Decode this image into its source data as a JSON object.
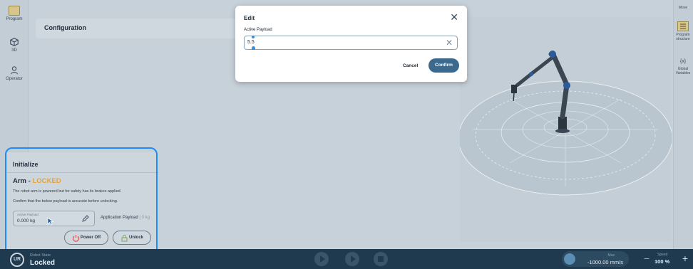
{
  "left_rail": {
    "items": [
      {
        "label": "Program",
        "icon": "program-icon"
      },
      {
        "label": "3D",
        "icon": "cube-icon"
      },
      {
        "label": "Operator",
        "icon": "person-icon"
      }
    ]
  },
  "right_rail": {
    "items": [
      {
        "label": "Move"
      },
      {
        "label": "Program structure"
      },
      {
        "icon_text": "{x}",
        "label": "Global Variables"
      }
    ]
  },
  "config": {
    "title": "Configuration"
  },
  "modal": {
    "title": "Edit",
    "close": "✕",
    "field_label": "Active Payload",
    "field_value": "5.5",
    "clear": "✕",
    "cancel": "Cancel",
    "confirm": "Confirm"
  },
  "initialize": {
    "title": "Initialize",
    "arm_prefix": "Arm -",
    "arm_state": "LOCKED",
    "text1": "The robot arm is powered but for safety has its brakes applied.",
    "text2": "Confirm that the below payload is accurate before unlocking.",
    "payload_label": "Active Payload",
    "payload_value": "0.000 kg",
    "app_payload_label": "Application Payload",
    "app_payload_value": "0 kg",
    "power_off": "Power Off",
    "unlock": "Unlock"
  },
  "bottom": {
    "logo": "UR",
    "robot_state_label": "Robot State",
    "robot_state_value": "Locked",
    "max_label": "Max",
    "max_value": "-1000.00 mm/s",
    "speed_label": "Speed",
    "speed_value": "100 %",
    "minus": "−",
    "plus": "+"
  },
  "colors": {
    "accent": "#3c6a8f",
    "highlight": "#1f8cf5",
    "locked": "#e3a43a",
    "bottom_bar": "#1f3a4e"
  }
}
